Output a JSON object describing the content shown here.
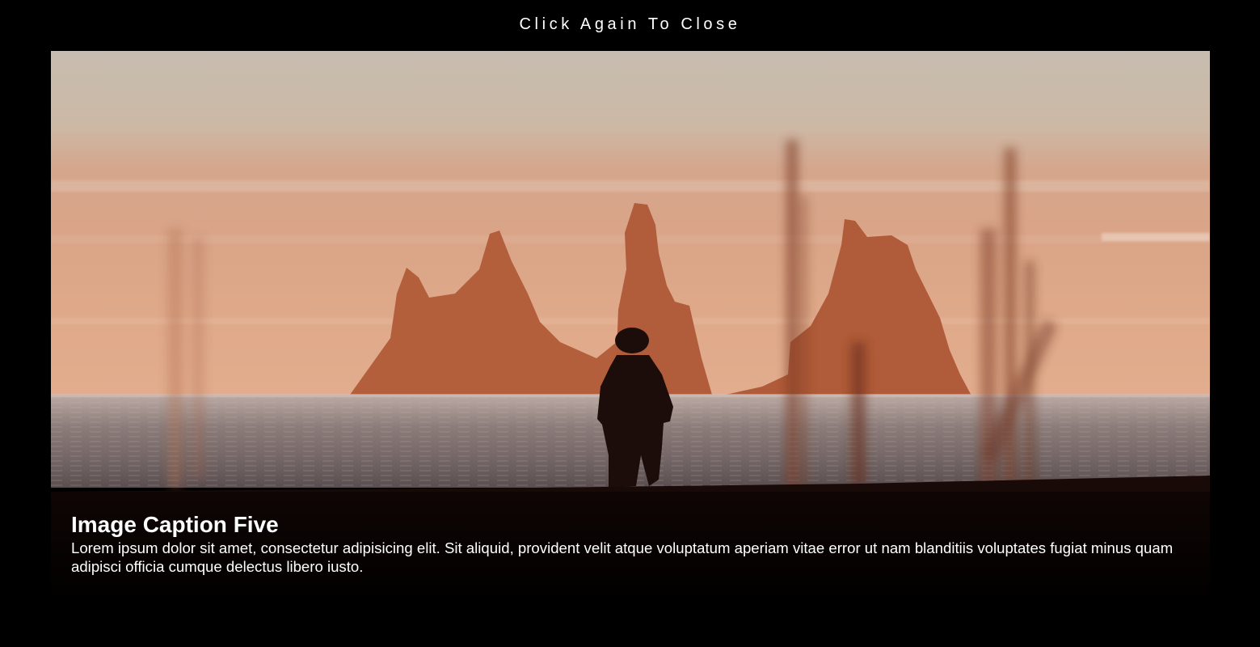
{
  "close_hint": "Click Again To Close",
  "photo": {
    "subject": "silhouette-on-beach-sea-stacks"
  },
  "caption": {
    "title": "Image Caption Five",
    "text": "Lorem ipsum dolor sit amet, consectetur adipisicing elit. Sit aliquid, provident velit atque voluptatum aperiam vitae error ut nam blanditiis voluptates fugiat minus quam adipisci officia cumque delectus libero iusto."
  },
  "colors": {
    "background": "#000000",
    "text": "#ffffff",
    "sky_top": "#c8bcae",
    "sky_haze": "#d9a48a",
    "rock": "#b8603e",
    "sea": "#8a7a78",
    "silhouette": "#1a0c08"
  }
}
